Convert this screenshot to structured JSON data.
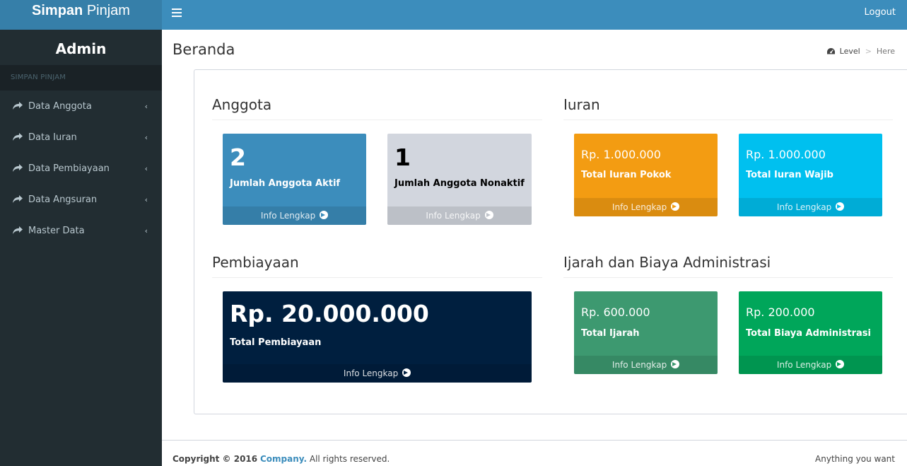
{
  "logo": {
    "bold": "Simpan",
    "rest": "Pinjam"
  },
  "header": {
    "logout": "Logout"
  },
  "sidebar": {
    "user": "Admin",
    "header": "SIMPAN PINJAM",
    "items": [
      {
        "label": "Data Anggota"
      },
      {
        "label": "Data Iuran"
      },
      {
        "label": "Data Pembiayaan"
      },
      {
        "label": "Data Angsuran"
      },
      {
        "label": "Master Data"
      }
    ]
  },
  "page": {
    "title": "Beranda",
    "breadcrumb": {
      "level": "Level",
      "here": "Here"
    }
  },
  "sections": {
    "anggota": "Anggota",
    "iuran": "Iuran",
    "pembiayaan": "Pembiayaan",
    "ijarah": "Ijarah dan Biaya Administrasi"
  },
  "boxes": {
    "info": "Info Lengkap",
    "aktif": {
      "value": "2",
      "label": "Jumlah Anggota Aktif",
      "color": "#3c8dbc"
    },
    "nonaktif": {
      "value": "1",
      "label": "Jumlah Anggota Nonaktif",
      "color": "#d2d6de"
    },
    "pokok": {
      "value": "Rp. 1.000.000",
      "label": "Total Iuran Pokok",
      "color": "#f39c12"
    },
    "wajib": {
      "value": "Rp. 1.000.000",
      "label": "Total Iuran Wajib",
      "color": "#00c0ef"
    },
    "pembiayaan": {
      "value": "Rp. 20.000.000",
      "label": "Total Pembiayaan",
      "color": "#001f3f"
    },
    "ijarah": {
      "value": "Rp. 600.000",
      "label": "Total Ijarah",
      "color": "#3d9970"
    },
    "admin": {
      "value": "Rp. 200.000",
      "label": "Total Biaya Administrasi",
      "color": "#00a65a"
    }
  },
  "footer": {
    "copyright": "Copyright © 2016",
    "company": "Company.",
    "rights": "All rights reserved.",
    "right": "Anything you want"
  }
}
